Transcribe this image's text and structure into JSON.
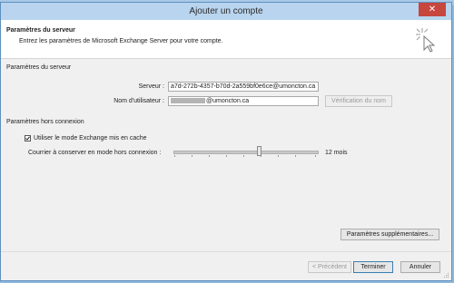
{
  "window": {
    "title": "Ajouter un compte",
    "close_glyph": "✕"
  },
  "header": {
    "title": "Paramètres du serveur",
    "subtitle": "Entrez les paramètres de Microsoft Exchange Server pour votre compte.",
    "icon": "wizard-cursor-icon"
  },
  "server_section": {
    "heading": "Paramètres du serveur",
    "server_label": "Serveur :",
    "server_value": "a7d-272b-4357-b70d-2a559bf0e6ce@umoncton.ca",
    "username_label": "Nom d'utilisateur :",
    "username_value": "@umoncton.ca",
    "check_name_button": "Vérification du nom"
  },
  "offline_section": {
    "heading": "Paramètres hors connexion",
    "cache_checkbox_label": "Utiliser le mode Exchange mis en cache",
    "cache_checked": true,
    "mail_to_keep_label": "Courrier à conserver en mode hors connexion :",
    "mail_to_keep_value": "12 mois"
  },
  "buttons": {
    "more_settings": "Paramètres supplémentaires...",
    "previous": "< Précédent",
    "finish": "Terminer",
    "cancel": "Annuler"
  },
  "colors": {
    "close": "#c7463e",
    "titlebar": "#b8d4ee",
    "accent": "#3c7fb1"
  }
}
